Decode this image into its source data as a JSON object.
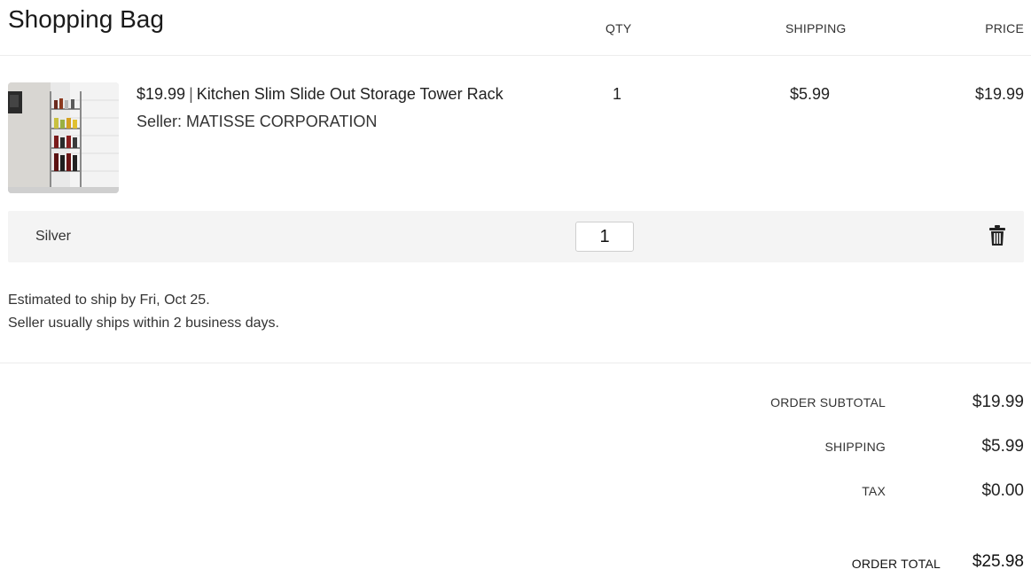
{
  "header": {
    "title": "Shopping Bag",
    "columns": {
      "qty": "QTY",
      "shipping": "SHIPPING",
      "price": "PRICE"
    }
  },
  "item": {
    "unit_price": "$19.99",
    "separator": "|",
    "name": "Kitchen Slim Slide Out Storage Tower Rack",
    "seller": "Seller: MATISSE CORPORATION",
    "qty": "1",
    "shipping": "$5.99",
    "price": "$19.99",
    "image_icon": "product-image",
    "variant": "Silver",
    "qty_input_value": "1",
    "delete_icon": "trash-icon"
  },
  "shipping_info": {
    "estimate": "Estimated to ship by Fri, Oct 25.",
    "note": "Seller usually ships within 2 business days."
  },
  "summary": {
    "subtotal_label": "ORDER SUBTOTAL",
    "subtotal_value": "$19.99",
    "shipping_label": "SHIPPING",
    "shipping_value": "$5.99",
    "tax_label": "TAX",
    "tax_value": "$0.00",
    "total_label": "ORDER TOTAL",
    "total_value": "$25.98"
  }
}
